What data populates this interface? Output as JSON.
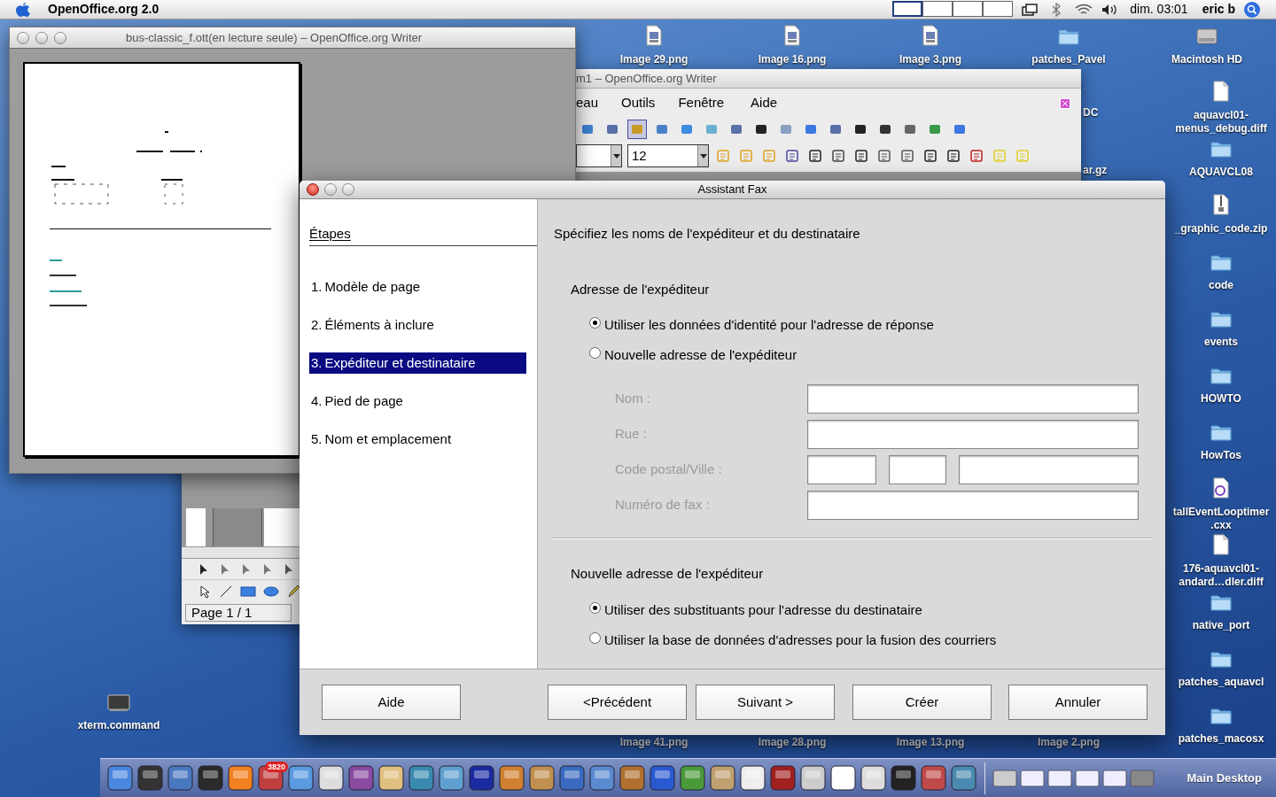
{
  "menubar": {
    "app_name": "OpenOffice.org 2.0",
    "clock": "dim. 03:01",
    "user": "eric b"
  },
  "desktop": {
    "top_row": [
      {
        "label": "Image 29.png",
        "kind": "png"
      },
      {
        "label": "Image 16.png",
        "kind": "png"
      },
      {
        "label": "Image 3.png",
        "kind": "png"
      },
      {
        "label": "patches_Pavel",
        "kind": "folder"
      },
      {
        "label": "Macintosh HD",
        "kind": "disk"
      }
    ],
    "right_column": [
      {
        "lines": [
          "aquavcl01-",
          "menus_debug.diff"
        ],
        "kind": "doc"
      },
      {
        "lines": [
          "AQUAVCL08"
        ],
        "kind": "folder"
      },
      {
        "lines": [
          "_graphic_code.zip"
        ],
        "kind": "zip"
      },
      {
        "lines": [
          "code"
        ],
        "kind": "folder"
      },
      {
        "lines": [
          "events"
        ],
        "kind": "folder"
      },
      {
        "lines": [
          "HOWTO"
        ],
        "kind": "folder"
      },
      {
        "lines": [
          "HowTos"
        ],
        "kind": "folder"
      },
      {
        "lines": [
          "tallEventLooptimer",
          ".cxx"
        ],
        "kind": "cxx"
      },
      {
        "lines": [
          "176-aquavcl01-",
          "andard…dler.diff"
        ],
        "kind": "doc"
      },
      {
        "lines": [
          "native_port"
        ],
        "kind": "folder"
      },
      {
        "lines": [
          "patches_aquavcl"
        ],
        "kind": "folder"
      },
      {
        "lines": [
          "patches_macosx"
        ],
        "kind": "folder"
      }
    ],
    "covered_labels": [
      "DC",
      "ar.gz"
    ],
    "bottom_row": [
      "Image 41.png",
      "Image 28.png",
      "Image 13.png",
      "Image 2.png"
    ],
    "loose": {
      "label": "xterm.command",
      "kind": "terminal"
    }
  },
  "doc_window": {
    "title": "bus-classic_f.ott(en lecture seule) – OpenOffice.org Writer"
  },
  "writer_window": {
    "title": "m1 – OpenOffice.org Writer",
    "menu": [
      "eau",
      "Outils",
      "Fenêtre",
      "Aide"
    ],
    "font_size": "12",
    "status": "Page 1 / 1"
  },
  "dialog": {
    "title": "Assistant Fax",
    "steps_heading": "Étapes",
    "steps": [
      {
        "number": "1.",
        "label": "Modèle de page",
        "selected": false
      },
      {
        "number": "2.",
        "label": "Éléments à inclure",
        "selected": false
      },
      {
        "number": "3.",
        "label": "Expéditeur et destinataire",
        "selected": true
      },
      {
        "number": "4.",
        "label": "Pied de page",
        "selected": false
      },
      {
        "number": "5.",
        "label": "Nom et emplacement",
        "selected": false
      }
    ],
    "heading": "Spécifiez les noms de l'expéditeur et du destinataire",
    "sender": {
      "title": "Adresse de l'expéditeur",
      "options": [
        {
          "label": "Utiliser les données d'identité pour l'adresse de réponse",
          "selected": true
        },
        {
          "label": "Nouvelle adresse de l'expéditeur",
          "selected": false
        }
      ],
      "fields": [
        {
          "label": "Nom :",
          "kind": "single",
          "disabled": true
        },
        {
          "label": "Rue :",
          "kind": "single",
          "disabled": true
        },
        {
          "label": "Code postal/Ville :",
          "kind": "triple",
          "disabled": true
        },
        {
          "label": "Numéro de fax :",
          "kind": "single",
          "disabled": true
        }
      ]
    },
    "recipient": {
      "title": "Nouvelle adresse de l'expéditeur",
      "options": [
        {
          "label": "Utiliser des substituants pour l'adresse du destinataire",
          "selected": true
        },
        {
          "label": "Utiliser la base de données d'adresses pour la fusion des courriers",
          "selected": false
        }
      ]
    },
    "buttons": [
      "Aide",
      "<Précédent",
      "Suivant >",
      "Créer",
      "Annuler"
    ]
  },
  "dock": {
    "mail_badge": "3820",
    "label": "Main Desktop"
  }
}
